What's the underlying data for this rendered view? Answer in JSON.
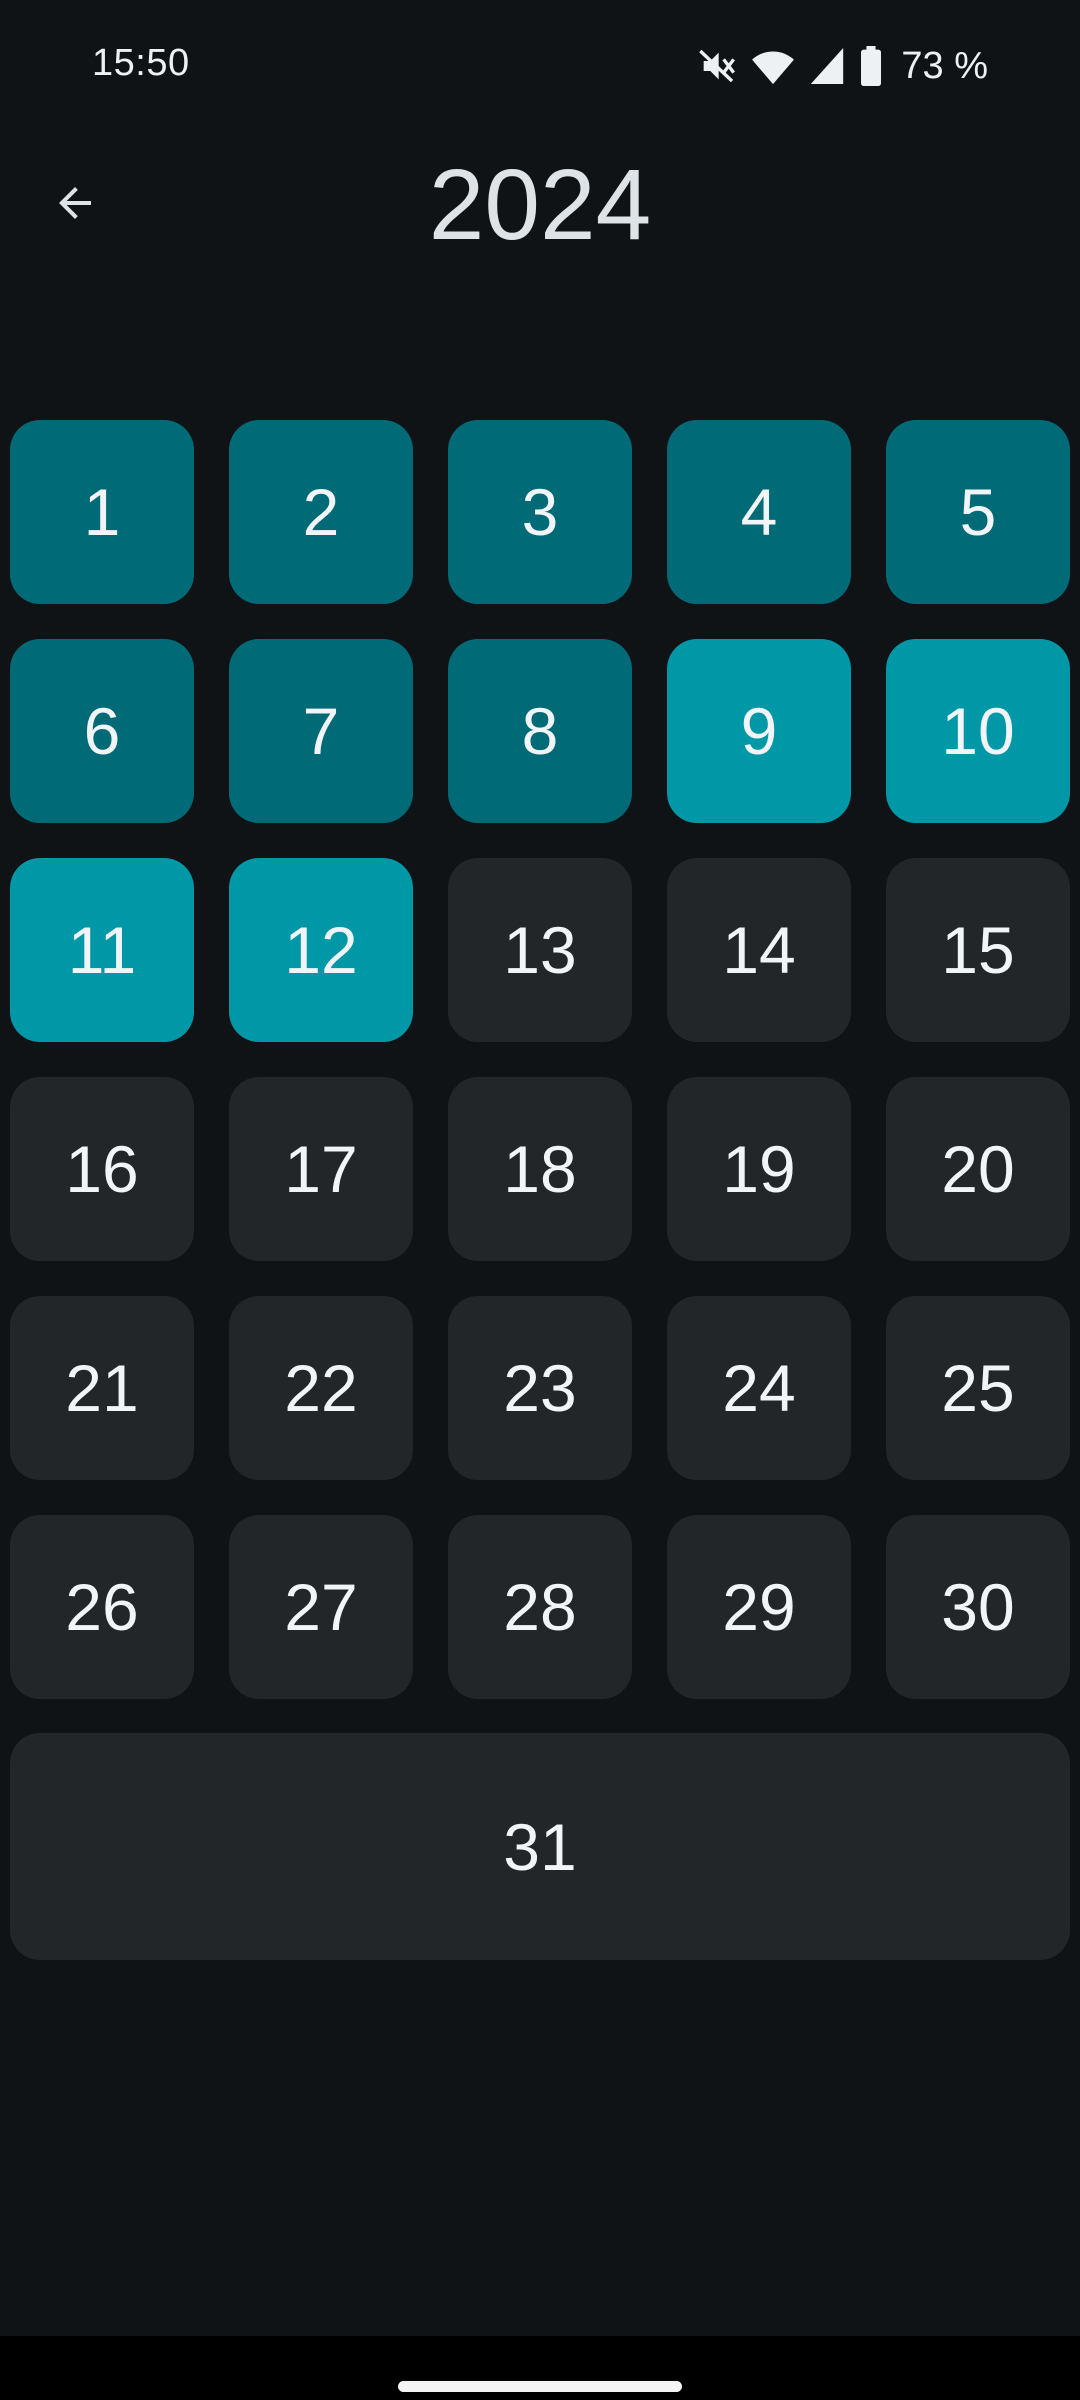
{
  "status_bar": {
    "time": "15:50",
    "battery": "73 %",
    "icons": [
      "mute-icon",
      "wifi-icon",
      "signal-icon",
      "battery-icon"
    ]
  },
  "header": {
    "title": "2024",
    "back_icon": "arrow-left-icon"
  },
  "colors": {
    "background": "#0f1316",
    "tile_past": "#006b77",
    "tile_recent": "#0097a7",
    "tile_future": "#232628"
  },
  "tiles": {
    "t1": "1",
    "t2": "2",
    "t3": "3",
    "t4": "4",
    "t5": "5",
    "t6": "6",
    "t7": "7",
    "t8": "8",
    "t9": "9",
    "t10": "10",
    "t11": "11",
    "t12": "12",
    "t13": "13",
    "t14": "14",
    "t15": "15",
    "t16": "16",
    "t17": "17",
    "t18": "18",
    "t19": "19",
    "t20": "20",
    "t21": "21",
    "t22": "22",
    "t23": "23",
    "t24": "24",
    "t25": "25",
    "t26": "26",
    "t27": "27",
    "t28": "28",
    "t29": "29",
    "t30": "30",
    "t31": "31"
  }
}
